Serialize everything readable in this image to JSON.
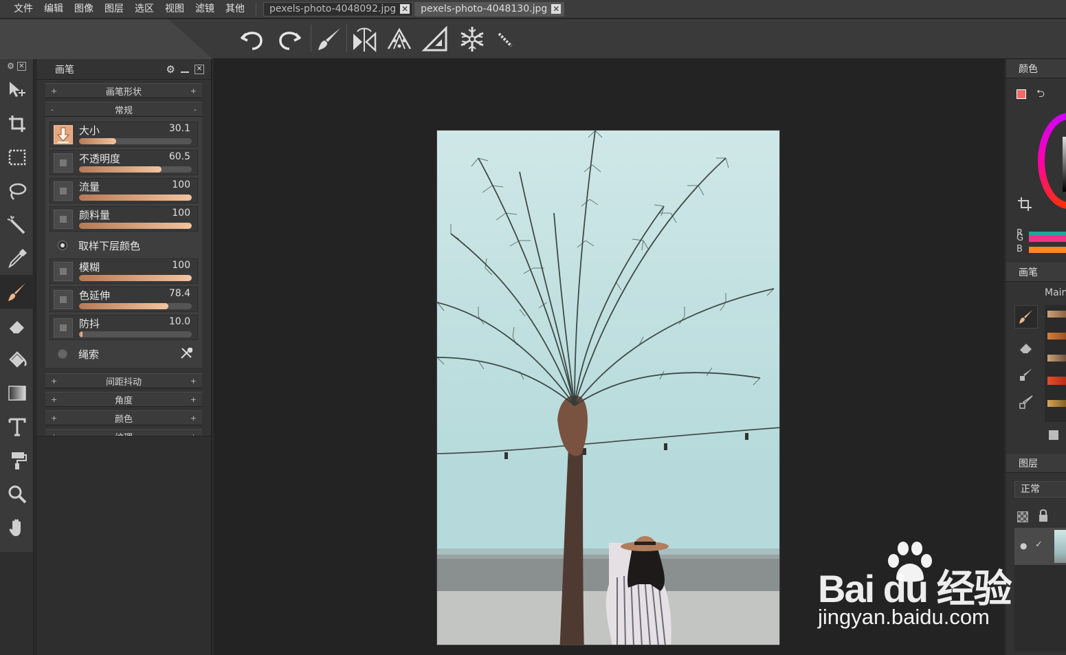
{
  "menu": {
    "items": [
      "文件",
      "编辑",
      "图像",
      "图层",
      "选区",
      "视图",
      "滤镜",
      "其他"
    ]
  },
  "tabs": [
    {
      "label": "pexels-photo-4048092.jpg",
      "active": false
    },
    {
      "label": "pexels-photo-4048130.jpg",
      "active": true
    }
  ],
  "toolbar": {
    "icons": [
      "undo-icon",
      "redo-icon",
      "brush-icon",
      "mirror-icon",
      "perspective-icon",
      "ruler-icon",
      "snowflake-icon",
      "line-ruler-icon"
    ]
  },
  "lefttools": {
    "icons": [
      "move-icon",
      "crop-icon",
      "marquee-icon",
      "lasso-icon",
      "magic-wand-icon",
      "eyedropper-icon",
      "paintbrush-icon",
      "eraser-icon",
      "paint-bucket-icon",
      "gradient-icon",
      "text-icon",
      "paint-roller-icon",
      "zoom-icon",
      "hand-icon"
    ],
    "active_index": 6
  },
  "brush_panel": {
    "title": "画笔",
    "section_brush_shape": "画笔形状",
    "section_general": "常规",
    "sliders": [
      {
        "label": "大小",
        "value": "30.1",
        "fraction": 0.33,
        "icon": "pressure-arrow-icon"
      },
      {
        "label": "不透明度",
        "value": "60.5",
        "fraction": 0.73
      },
      {
        "label": "流量",
        "value": "100",
        "fraction": 1.0
      },
      {
        "label": "颜料量",
        "value": "100",
        "fraction": 1.0
      }
    ],
    "sample_below_label": "取样下层颜色",
    "sliders2": [
      {
        "label": "模糊",
        "value": "100",
        "fraction": 1.0
      },
      {
        "label": "色延伸",
        "value": "78.4",
        "fraction": 0.79
      },
      {
        "label": "防抖",
        "value": "10.0",
        "fraction": 0.03
      }
    ],
    "rope_label": "绳索",
    "sections_collapsed": [
      "间距抖动",
      "角度",
      "颜色",
      "纹理"
    ],
    "plus": "+",
    "minus": "-"
  },
  "right_panel": {
    "color_title": "颜色",
    "rgb_labels": [
      "R",
      "G",
      "B"
    ],
    "brush_title": "画笔",
    "brush_set": "Main",
    "layers_title": "图层",
    "blend_mode": "正常"
  },
  "watermark": {
    "big": "Bai du 经验",
    "small": "jingyan.baidu.com"
  },
  "colors": {
    "accent_fill_start": "#b67a55",
    "accent_fill_end": "#f3c49e",
    "r_bar": "#21a59c",
    "g_bar": "#f2338a",
    "b_bar": "#ff8a1f",
    "fg_color": "#f06a6a"
  }
}
